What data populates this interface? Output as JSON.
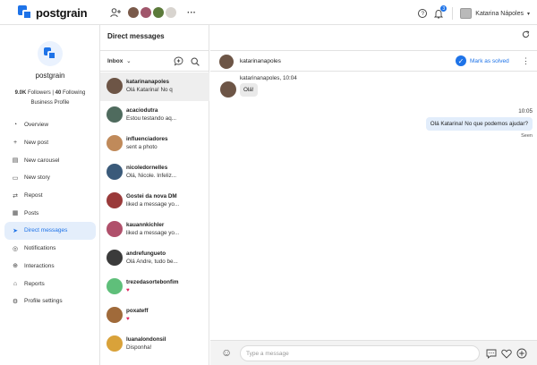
{
  "brand": {
    "name": "postgrain",
    "color": "#1e73e8"
  },
  "topbar": {
    "add_user_icon": "add-user-icon",
    "account_avatars": [
      {
        "color": "#7a5a4a"
      },
      {
        "color": "#a0566b"
      },
      {
        "color": "#5b7a3a"
      },
      {
        "color": "#d8d4cf"
      }
    ],
    "more": "···",
    "help_icon": "?",
    "notifications_badge": "3",
    "user_name": "Katarina Nápoles"
  },
  "profile": {
    "name": "postgrain",
    "followers": "9.0K",
    "followers_label": "Followers",
    "following": "40",
    "following_label": "Following",
    "type": "Business Profile"
  },
  "nav": [
    {
      "id": "overview",
      "label": "Overview",
      "icon": "◔"
    },
    {
      "id": "new-post",
      "label": "New post",
      "icon": "+"
    },
    {
      "id": "new-carousel",
      "label": "New carousel",
      "icon": "▤"
    },
    {
      "id": "new-story",
      "label": "New story",
      "icon": "▭"
    },
    {
      "id": "repost",
      "label": "Repost",
      "icon": "⇄"
    },
    {
      "id": "posts",
      "label": "Posts",
      "icon": "▦"
    },
    {
      "id": "direct-messages",
      "label": "Direct messages",
      "icon": "➤",
      "active": true
    },
    {
      "id": "notifications",
      "label": "Notifications",
      "icon": "◎"
    },
    {
      "id": "interactions",
      "label": "Interactions",
      "icon": "⊕"
    },
    {
      "id": "reports",
      "label": "Reports",
      "icon": "⌂"
    },
    {
      "id": "profile-settings",
      "label": "Profile settings",
      "icon": "⚙"
    }
  ],
  "conversations_panel": {
    "title": "Direct messages",
    "inbox_label": "Inbox",
    "items": [
      {
        "name": "katarinanapoles",
        "snippet": "Olá Katarina! No q",
        "color": "#6d5546",
        "selected": true
      },
      {
        "name": "acaciodutra",
        "snippet": "Estou testando aq...",
        "color": "#4f6b5e"
      },
      {
        "name": "influenciadores",
        "snippet": "sent a photo",
        "color": "#c08a5a"
      },
      {
        "name": "nicoledornelles",
        "snippet": "Olá, Nicole. Infeliz...",
        "color": "#3a5a7a"
      },
      {
        "name": "Gostei da nova DM",
        "snippet": "liked a message yo...",
        "color": "#9a3a3a"
      },
      {
        "name": "kauannkichler",
        "snippet": "liked a message yo...",
        "color": "#b0506b"
      },
      {
        "name": "andrefungueto",
        "snippet": "Olá Andre, tudo be...",
        "color": "#3b3b3b"
      },
      {
        "name": "trezedasortebonfim",
        "snippet": "♥",
        "color": "#5fbf7a"
      },
      {
        "name": "poxateff",
        "snippet": "♥",
        "color": "#a06a3a"
      },
      {
        "name": "luanalondonsil",
        "snippet": "Disponha!",
        "color": "#d9a23a"
      }
    ]
  },
  "chat": {
    "contact": "katarinanapoles",
    "contact_color": "#6d5546",
    "mark_solved_label": "Mark as solved",
    "incoming": {
      "meta": "katarinanapoles, 10:04",
      "text": "Olá!"
    },
    "outgoing": {
      "time": "10:05",
      "text": "Olá Katarina! No que podemos ajudar?",
      "status": "Seen"
    },
    "composer_placeholder": "Type a message"
  }
}
